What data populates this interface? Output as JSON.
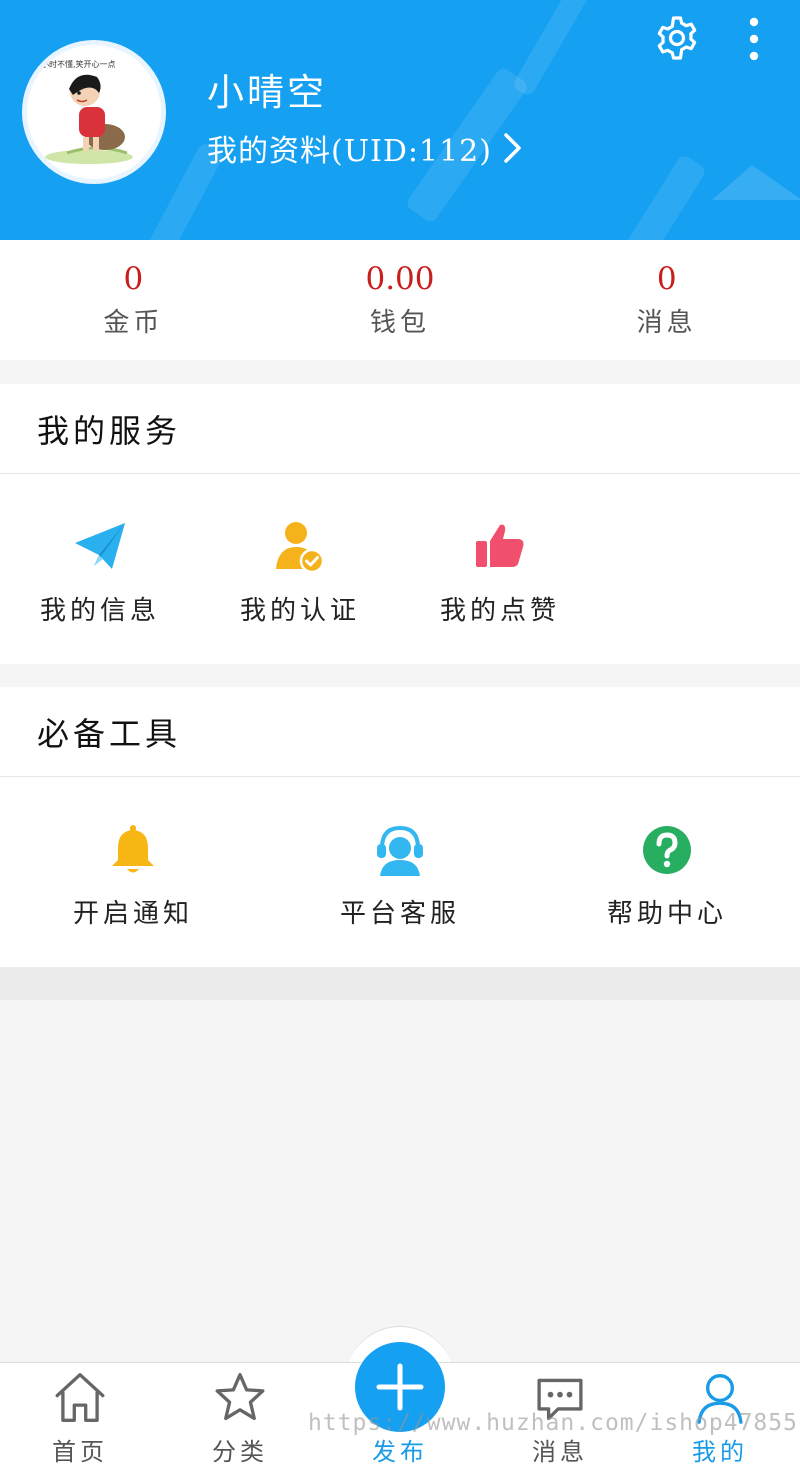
{
  "header": {
    "user_name": "小晴空",
    "profile_link": "我的资料(UID:112)",
    "avatar_caption": "小时不懂,笑开心一点",
    "icons": {
      "settings": "gear-icon",
      "more": "more-vertical-icon",
      "chevron": "chevron-right-icon"
    },
    "colors": {
      "background": "#15a0f2"
    }
  },
  "stats": [
    {
      "value": "0",
      "label": "金币"
    },
    {
      "value": "0.00",
      "label": "钱包"
    },
    {
      "value": "0",
      "label": "消息"
    }
  ],
  "stats_value_color": "#c81e1e",
  "services": {
    "title": "我的服务",
    "items": [
      {
        "label": "我的信息",
        "icon": "paper-plane-icon",
        "color": "#2ab0ee"
      },
      {
        "label": "我的认证",
        "icon": "user-verified-icon",
        "color": "#f5b21a"
      },
      {
        "label": "我的点赞",
        "icon": "thumbs-up-icon",
        "color": "#f0506e"
      }
    ]
  },
  "tools": {
    "title": "必备工具",
    "items": [
      {
        "label": "开启通知",
        "icon": "bell-icon",
        "color": "#f7b614"
      },
      {
        "label": "平台客服",
        "icon": "customer-service-icon",
        "color": "#33b7f0"
      },
      {
        "label": "帮助中心",
        "icon": "help-circle-icon",
        "color": "#27ae60"
      }
    ]
  },
  "bottom_nav": {
    "items": [
      {
        "label": "首页",
        "icon": "home-icon"
      },
      {
        "label": "分类",
        "icon": "star-icon"
      },
      {
        "label": "发布",
        "icon": "plus-icon"
      },
      {
        "label": "消息",
        "icon": "chat-bubble-icon"
      },
      {
        "label": "我的",
        "icon": "user-icon",
        "active": true
      }
    ],
    "active_color": "#1a9be8"
  },
  "watermark": "https://www.huzhan.com/ishop47855"
}
